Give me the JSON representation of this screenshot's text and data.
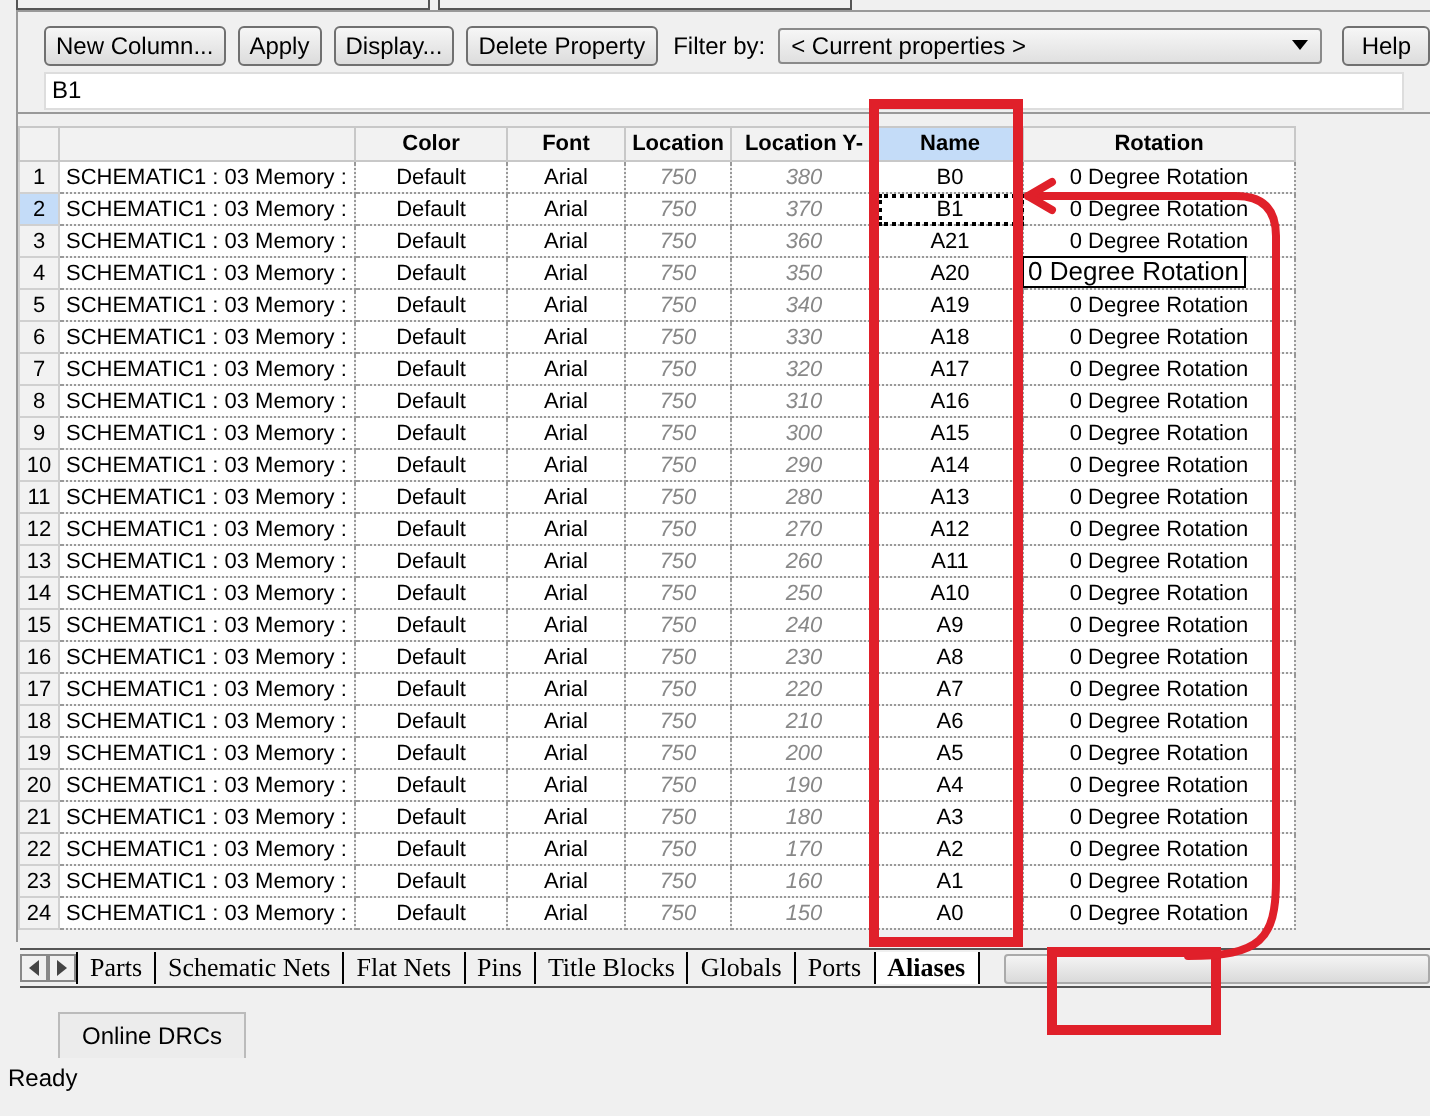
{
  "toolbar": {
    "buttons": [
      "New Column...",
      "Apply",
      "Display...",
      "Delete Property"
    ],
    "filter_label": "Filter by:",
    "filter_value": "< Current properties >",
    "help_button": "Help"
  },
  "edit_field": {
    "value": "B1"
  },
  "table": {
    "columns": [
      {},
      {
        "label": "Color",
        "selected": false
      },
      {
        "label": "Font",
        "selected": false
      },
      {
        "label": "Location",
        "selected": false
      },
      {
        "label": "Location Y-",
        "selected": false
      },
      {
        "label": "Name",
        "selected": true
      },
      {
        "label": "Rotation",
        "selected": false
      }
    ],
    "rows": [
      {
        "number": "1",
        "selected": false,
        "cells": [
          "SCHEMATIC1 : 03 Memory :",
          "Default",
          "Arial",
          "750",
          "380",
          "B0",
          "0 Degree Rotation"
        ]
      },
      {
        "number": "2",
        "selected": true,
        "cells": [
          "SCHEMATIC1 : 03 Memory :",
          "Default",
          "Arial",
          "750",
          "370",
          "B1",
          "0 Degree Rotation"
        ]
      },
      {
        "number": "3",
        "selected": false,
        "cells": [
          "SCHEMATIC1 : 03 Memory :",
          "Default",
          "Arial",
          "750",
          "360",
          "A21",
          "0 Degree Rotation"
        ]
      },
      {
        "number": "4",
        "selected": false,
        "cells": [
          "SCHEMATIC1 : 03 Memory :",
          "Default",
          "Arial",
          "750",
          "350",
          "A20",
          ""
        ]
      },
      {
        "number": "5",
        "selected": false,
        "cells": [
          "SCHEMATIC1 : 03 Memory :",
          "Default",
          "Arial",
          "750",
          "340",
          "A19",
          "0 Degree Rotation"
        ]
      },
      {
        "number": "6",
        "selected": false,
        "cells": [
          "SCHEMATIC1 : 03 Memory :",
          "Default",
          "Arial",
          "750",
          "330",
          "A18",
          "0 Degree Rotation"
        ]
      },
      {
        "number": "7",
        "selected": false,
        "cells": [
          "SCHEMATIC1 : 03 Memory :",
          "Default",
          "Arial",
          "750",
          "320",
          "A17",
          "0 Degree Rotation"
        ]
      },
      {
        "number": "8",
        "selected": false,
        "cells": [
          "SCHEMATIC1 : 03 Memory :",
          "Default",
          "Arial",
          "750",
          "310",
          "A16",
          "0 Degree Rotation"
        ]
      },
      {
        "number": "9",
        "selected": false,
        "cells": [
          "SCHEMATIC1 : 03 Memory :",
          "Default",
          "Arial",
          "750",
          "300",
          "A15",
          "0 Degree Rotation"
        ]
      },
      {
        "number": "10",
        "selected": false,
        "cells": [
          "SCHEMATIC1 : 03 Memory :",
          "Default",
          "Arial",
          "750",
          "290",
          "A14",
          "0 Degree Rotation"
        ]
      },
      {
        "number": "11",
        "selected": false,
        "cells": [
          "SCHEMATIC1 : 03 Memory :",
          "Default",
          "Arial",
          "750",
          "280",
          "A13",
          "0 Degree Rotation"
        ]
      },
      {
        "number": "12",
        "selected": false,
        "cells": [
          "SCHEMATIC1 : 03 Memory :",
          "Default",
          "Arial",
          "750",
          "270",
          "A12",
          "0 Degree Rotation"
        ]
      },
      {
        "number": "13",
        "selected": false,
        "cells": [
          "SCHEMATIC1 : 03 Memory :",
          "Default",
          "Arial",
          "750",
          "260",
          "A11",
          "0 Degree Rotation"
        ]
      },
      {
        "number": "14",
        "selected": false,
        "cells": [
          "SCHEMATIC1 : 03 Memory :",
          "Default",
          "Arial",
          "750",
          "250",
          "A10",
          "0 Degree Rotation"
        ]
      },
      {
        "number": "15",
        "selected": false,
        "cells": [
          "SCHEMATIC1 : 03 Memory :",
          "Default",
          "Arial",
          "750",
          "240",
          "A9",
          "0 Degree Rotation"
        ]
      },
      {
        "number": "16",
        "selected": false,
        "cells": [
          "SCHEMATIC1 : 03 Memory :",
          "Default",
          "Arial",
          "750",
          "230",
          "A8",
          "0 Degree Rotation"
        ]
      },
      {
        "number": "17",
        "selected": false,
        "cells": [
          "SCHEMATIC1 : 03 Memory :",
          "Default",
          "Arial",
          "750",
          "220",
          "A7",
          "0 Degree Rotation"
        ]
      },
      {
        "number": "18",
        "selected": false,
        "cells": [
          "SCHEMATIC1 : 03 Memory :",
          "Default",
          "Arial",
          "750",
          "210",
          "A6",
          "0 Degree Rotation"
        ]
      },
      {
        "number": "19",
        "selected": false,
        "cells": [
          "SCHEMATIC1 : 03 Memory :",
          "Default",
          "Arial",
          "750",
          "200",
          "A5",
          "0 Degree Rotation"
        ]
      },
      {
        "number": "20",
        "selected": false,
        "cells": [
          "SCHEMATIC1 : 03 Memory :",
          "Default",
          "Arial",
          "750",
          "190",
          "A4",
          "0 Degree Rotation"
        ]
      },
      {
        "number": "21",
        "selected": false,
        "cells": [
          "SCHEMATIC1 : 03 Memory :",
          "Default",
          "Arial",
          "750",
          "180",
          "A3",
          "0 Degree Rotation"
        ]
      },
      {
        "number": "22",
        "selected": false,
        "cells": [
          "SCHEMATIC1 : 03 Memory :",
          "Default",
          "Arial",
          "750",
          "170",
          "A2",
          "0 Degree Rotation"
        ]
      },
      {
        "number": "23",
        "selected": false,
        "cells": [
          "SCHEMATIC1 : 03 Memory :",
          "Default",
          "Arial",
          "750",
          "160",
          "A1",
          "0 Degree Rotation"
        ]
      },
      {
        "number": "24",
        "selected": false,
        "cells": [
          "SCHEMATIC1 : 03 Memory :",
          "Default",
          "Arial",
          "750",
          "150",
          "A0",
          "0 Degree Rotation"
        ]
      }
    ],
    "tooltip": "0 Degree Rotation"
  },
  "sheet_tabs": [
    {
      "label": "Parts",
      "selected": false
    },
    {
      "label": "Schematic Nets",
      "selected": false
    },
    {
      "label": "Flat Nets",
      "selected": false
    },
    {
      "label": "Pins",
      "selected": false
    },
    {
      "label": "Title Blocks",
      "selected": false
    },
    {
      "label": "Globals",
      "selected": false
    },
    {
      "label": "Ports",
      "selected": false
    },
    {
      "label": "Aliases",
      "selected": true
    }
  ],
  "bottom_tab": "Online DRCs",
  "status_bar": "Ready"
}
